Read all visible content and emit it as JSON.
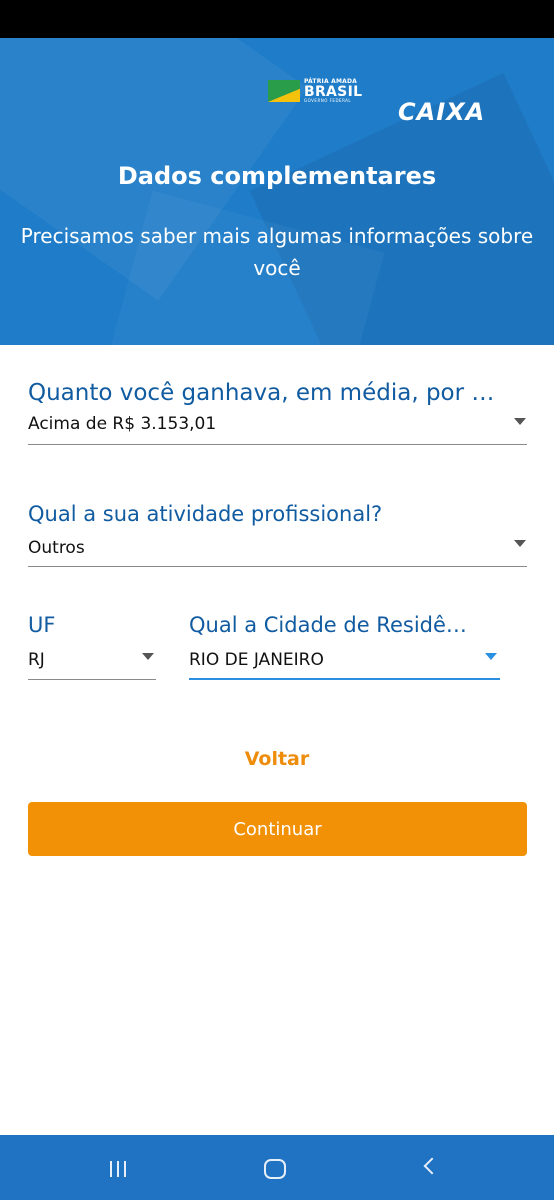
{
  "header": {
    "brasil_logo": {
      "line1": "PÁTRIA AMADA",
      "line2": "BRASIL",
      "line3": "GOVERNO FEDERAL"
    },
    "caixa_logo": "CAIXA",
    "title": "Dados complementares",
    "subtitle": "Precisamos saber mais algumas informações sobre você"
  },
  "form": {
    "income": {
      "label": "Quanto você ganhava, em média, por mês?",
      "value": "Acima de R$ 3.153,01"
    },
    "activity": {
      "label": "Qual a sua atividade profissional?",
      "value": "Outros"
    },
    "uf": {
      "label": "UF",
      "value": "RJ"
    },
    "city": {
      "label": "Qual a Cidade de Residência?",
      "value": "RIO DE JANEIRO"
    }
  },
  "actions": {
    "back_label": "Voltar",
    "continue_label": "Continuar"
  },
  "colors": {
    "header_blue": "#1f7cc8",
    "label_blue": "#115ba1",
    "accent_orange": "#f29106",
    "active_blue": "#2a8fe0",
    "nav_blue": "#1f73c2"
  },
  "nav": {
    "recent_icon": "recent-apps-icon",
    "home_icon": "home-icon",
    "back_icon": "back-icon"
  }
}
